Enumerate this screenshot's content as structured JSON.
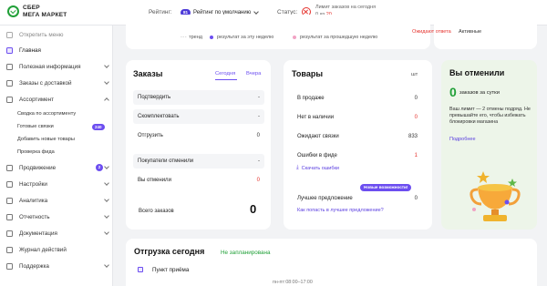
{
  "brand": {
    "line1": "СБЕР",
    "line2": "МЕГА МАРКЕТ"
  },
  "header": {
    "rating_label": "Рейтинг:",
    "rating_badge": "81",
    "rating_value": "Рейтинг по умолчанию",
    "status_label": "Статус:",
    "limit_title": "Лимит заказов на сегодня",
    "limit_used": "0 из",
    "limit_total": "20"
  },
  "sidebar": {
    "collapse": "Открепить меню",
    "items": [
      {
        "label": "Главная"
      },
      {
        "label": "Полезная информация"
      },
      {
        "label": "Заказы с доставкой"
      },
      {
        "label": "Ассортимент"
      },
      {
        "label": "Продвижение",
        "badge": "2"
      },
      {
        "label": "Настройки"
      },
      {
        "label": "Аналитика"
      },
      {
        "label": "Отчетность"
      },
      {
        "label": "Документация"
      },
      {
        "label": "Журнал действий"
      },
      {
        "label": "Поддержка"
      }
    ],
    "sub_items": [
      {
        "label": "Сводка по ассортименту"
      },
      {
        "label": "Готовые связки",
        "badge": "240"
      },
      {
        "label": "Добавить новые товары"
      },
      {
        "label": "Проверка фида"
      }
    ]
  },
  "chart_legend": {
    "trend": "тренд",
    "this_week": "результат за эту неделю",
    "last_week": "результат за прошедшую неделю"
  },
  "top_cards": {
    "awaiting_answer": "Ожидают ответа",
    "active": "Активные"
  },
  "orders": {
    "title": "Заказы",
    "tab_today": "Сегодня",
    "tab_yesterday": "Вчера",
    "rows": [
      {
        "label": "Подтвердить",
        "value": "-"
      },
      {
        "label": "Скомплектовать",
        "value": "-"
      },
      {
        "label": "Отгрузить",
        "value": "0"
      },
      {
        "label": "Покупатели отменили",
        "value": "-"
      },
      {
        "label": "Вы отменили",
        "value": "0"
      }
    ],
    "total_label": "Всего заказов",
    "total_value": "0"
  },
  "products": {
    "title": "Товары",
    "unit": "шт",
    "rows": [
      {
        "label": "В продаже",
        "value": "0"
      },
      {
        "label": "Нет в наличии",
        "value": "0"
      },
      {
        "label": "Ожидают связки",
        "value": "833"
      },
      {
        "label": "Ошибки в фиде",
        "value": "1"
      }
    ],
    "download_errors": "Скачать ошибки",
    "new_badge": "Новые возможности!",
    "best_offer_label": "Лучшее предложение",
    "best_offer_value": "0",
    "best_offer_link": "Как попасть в лучшее предложение?"
  },
  "cancelled": {
    "title": "Вы отменили",
    "count": "0",
    "count_caption": "заказов за сутки",
    "text": "Ваш лимит — 2 отмены подряд. Не превышайте его, чтобы избежать блокировки магазина",
    "more": "Подробнее"
  },
  "shipment": {
    "title": "Отгрузка сегодня",
    "status": "Не запланирована",
    "point": "Пункт приёма",
    "hours": "пн-пт:08:00–17:00"
  },
  "colors": {
    "accent": "#6c4ef0",
    "green": "#21a038",
    "red": "#e5322d"
  }
}
